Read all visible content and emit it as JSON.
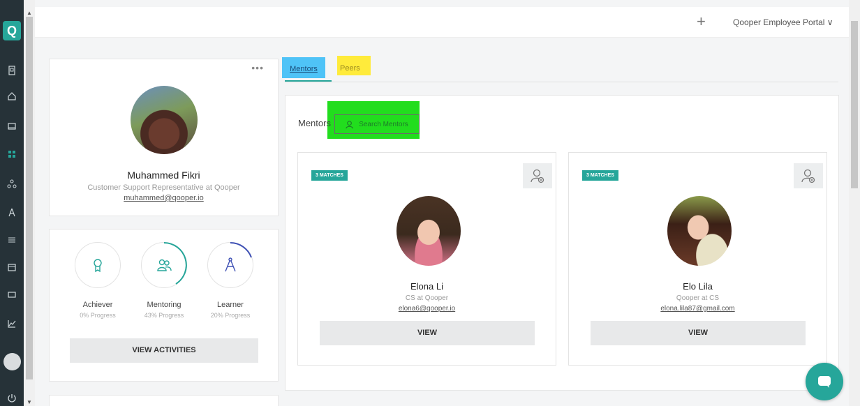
{
  "app": {
    "logo_letter": "Q",
    "portal_name": "Qooper Employee Portal",
    "portal_chevron": "∨",
    "add_icon": "+"
  },
  "nav": {
    "icons": [
      "building-icon",
      "home-icon",
      "inbox-icon",
      "people-grid-icon",
      "network-icon",
      "compass-icon",
      "list-icon",
      "calendar-icon",
      "card-icon",
      "chart-icon",
      "power-icon"
    ]
  },
  "profile": {
    "more_icon": "•••",
    "name": "Muhammed Fikri",
    "role": "Customer Support Representative at Qooper",
    "email": "muhammed@qooper.io"
  },
  "progress": {
    "items": [
      {
        "label": "Achiever",
        "sub": "0% Progress",
        "value": 0
      },
      {
        "label": "Mentoring",
        "sub": "43% Progress",
        "value": 43
      },
      {
        "label": "Learner",
        "sub": "20% Progress",
        "value": 20
      }
    ],
    "view_activities_label": "VIEW ACTIVITIES"
  },
  "tabs": {
    "mentors": "Mentors",
    "peers": "Peers"
  },
  "mentors_panel": {
    "title": "Mentors",
    "search_label": "Search Mentors",
    "cards": [
      {
        "badge": "3 MATCHES",
        "name": "Elona Li",
        "role": "CS at Qooper",
        "email": "elona6@qooper.io",
        "view_label": "VIEW"
      },
      {
        "badge": "3 MATCHES",
        "name": "Elo Lila",
        "role": "Qooper at CS",
        "email": "elona.lila87@gmail.com",
        "view_label": "VIEW"
      }
    ]
  },
  "colors": {
    "accent": "#26a69a",
    "sidebar": "#263238",
    "highlight_blue": "#4fc3f7",
    "highlight_yellow": "#ffeb3b",
    "highlight_green": "#22dd1e"
  }
}
